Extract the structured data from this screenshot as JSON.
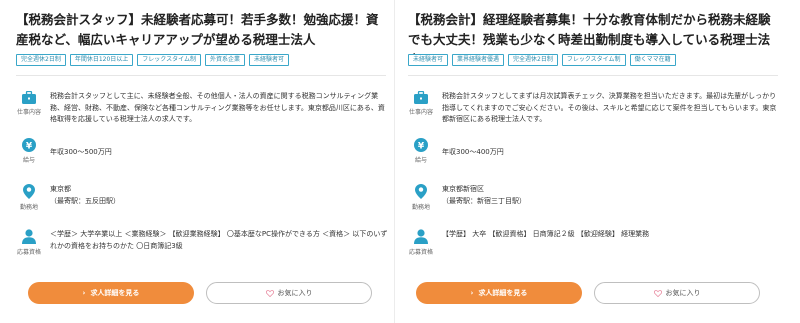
{
  "colors": {
    "accent": "#3aa7c9",
    "icon": "#2aa0c6",
    "primary_button": "#f08c3c",
    "heart": "#e88aa0"
  },
  "cards": [
    {
      "title": "【税務会計スタッフ】未経験者応募可！若手多数！勉強応援！資産税など、幅広いキャリアアップが望める税理士法人",
      "tags": [
        "完全週休2日制",
        "年間休日120日以上",
        "フレックスタイム制",
        "外資系企業",
        "未経験者可"
      ],
      "job": {
        "caption": "仕事内容",
        "icon": "briefcase-icon",
        "text": "税務会計スタッフとして主に、未経験者全般、その他個人・法人の資産に関する税務コンサルティング業務、経営、財務、不動産、保険など各種コンサルティング業務等をお任せします。東京都品川区にある、資格取得を応援している税理士法人の求人です。"
      },
      "salary": {
        "caption": "給与",
        "icon": "yen-icon",
        "text": "年収300～500万円"
      },
      "location": {
        "caption": "勤務地",
        "icon": "pin-icon",
        "line1": "東京都",
        "line2": "（最寄駅：五反田駅）"
      },
      "qual": {
        "caption": "応募資格",
        "icon": "person-icon",
        "text": "＜学歴＞ 大学卒業以上 ＜業務経験＞ 【歓迎業務経験】 〇基本歴なPC操作ができる方 ＜資格＞ 以下のいずれかの資格をお持ちのかた 〇日商簿記3級"
      },
      "apply_label": "求人詳細を見る",
      "fav_label": "お気に入り"
    },
    {
      "title": "【税務会計】経理経験者募集！十分な教育体制だから税務未経験でも大丈夫！残業も少なく時差出勤制度も導入している税理士法人",
      "tags": [
        "未経験者可",
        "業界経験者優遇",
        "完全週休2日制",
        "フレックスタイム制",
        "働くママ在籍"
      ],
      "job": {
        "caption": "仕事内容",
        "icon": "briefcase-icon",
        "text": "税務会計スタッフとしてまずは月次試算表チェック、決算業務を担当いただきます。最初は先輩がしっかり指導してくれますのでご安心ください。その後は、スキルと希望に応じて案件を担当してもらいます。東京都新宿区にある税理士法人です。"
      },
      "salary": {
        "caption": "給与",
        "icon": "yen-icon",
        "text": "年収300～400万円"
      },
      "location": {
        "caption": "勤務地",
        "icon": "pin-icon",
        "line1": "東京都新宿区",
        "line2": "（最寄駅：新宿三丁目駅）"
      },
      "qual": {
        "caption": "応募資格",
        "icon": "person-icon",
        "text": "【学歴】 大卒 【歓迎資格】 日商簿記２級 【歓迎経験】 経理業務"
      },
      "apply_label": "求人詳細を見る",
      "fav_label": "お気に入り"
    }
  ]
}
